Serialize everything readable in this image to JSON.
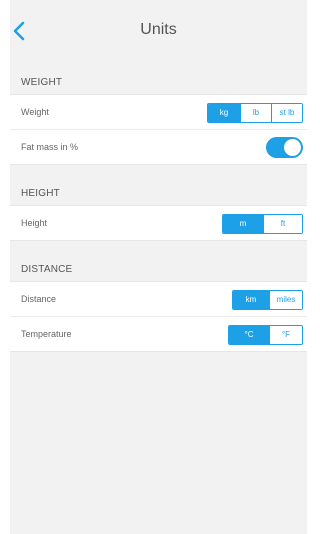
{
  "header": {
    "title": "Units",
    "back_icon": "chevron-left-icon"
  },
  "colors": {
    "accent": "#1ea0e6",
    "background": "#f2f2f2"
  },
  "sections": {
    "weight": {
      "label": "WEIGHT",
      "weight_row": {
        "label": "Weight",
        "options": [
          "kg",
          "lb",
          "st lb"
        ],
        "selected": "kg"
      },
      "fat_row": {
        "label": "Fat mass in %",
        "toggle_on": true
      }
    },
    "height": {
      "label": "HEIGHT",
      "height_row": {
        "label": "Height",
        "options": [
          "m",
          "ft"
        ],
        "selected": "m"
      }
    },
    "distance": {
      "label": "DISTANCE",
      "distance_row": {
        "label": "Distance",
        "options": [
          "km",
          "miles"
        ],
        "selected": "km"
      },
      "temperature_row": {
        "label": "Temperature",
        "options": [
          "°C",
          "°F"
        ],
        "selected": "°C"
      }
    }
  }
}
